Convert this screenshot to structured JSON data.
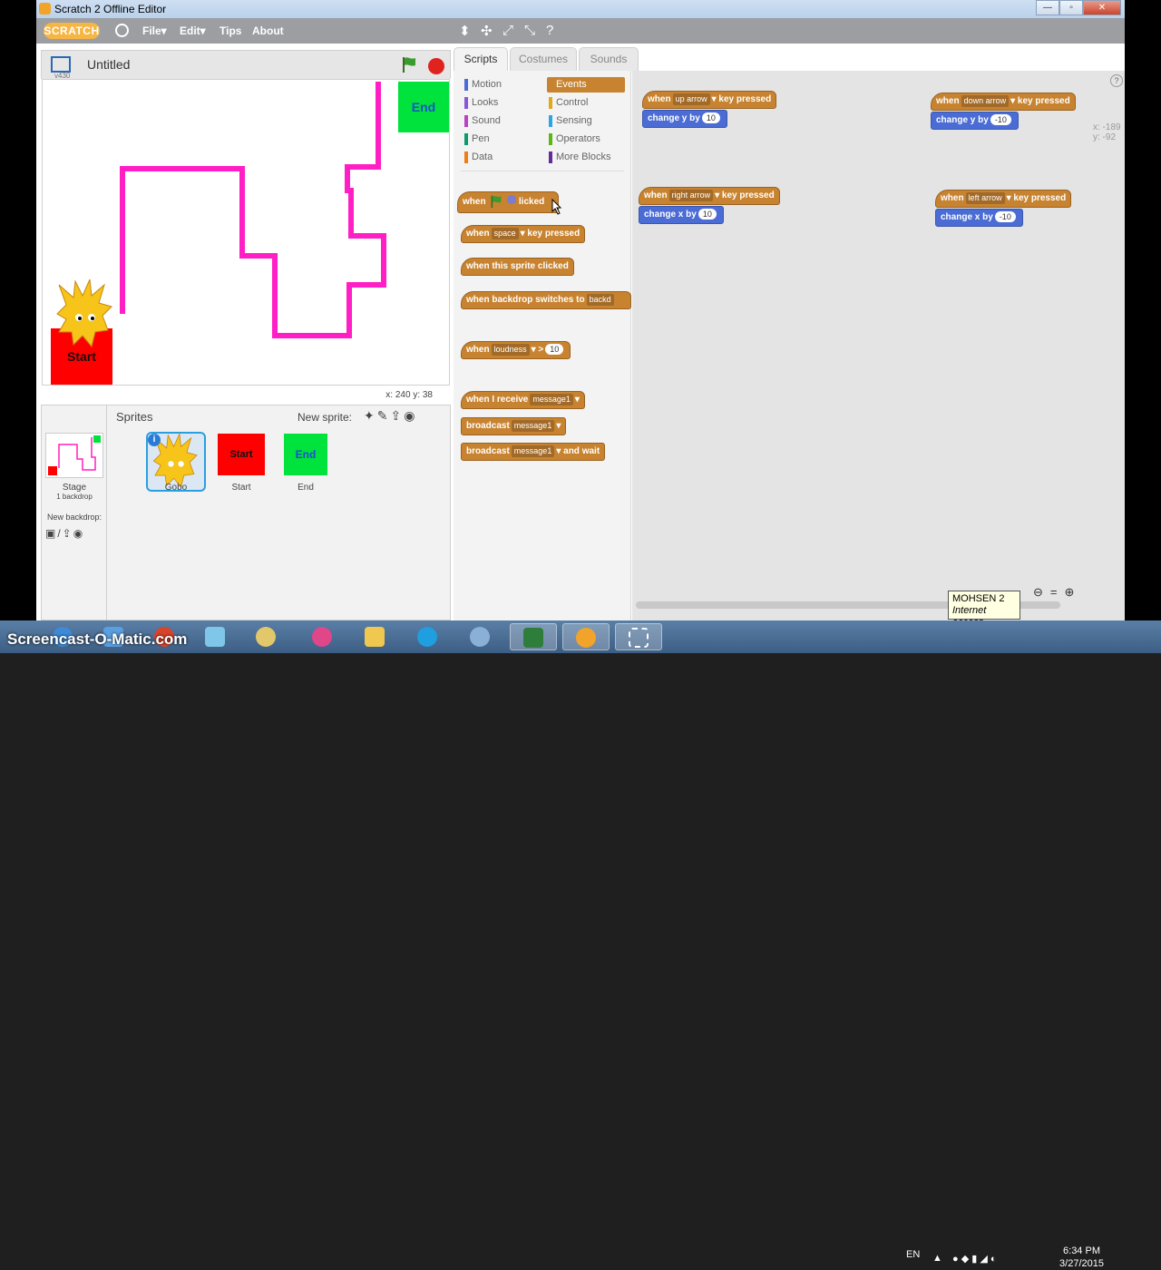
{
  "window": {
    "title": "Scratch 2 Offline Editor"
  },
  "menubar": {
    "logo": "SCRATCH",
    "items": [
      "File",
      "Edit",
      "Tips",
      "About"
    ],
    "file_label": "File▾",
    "edit_label": "Edit▾",
    "tips_label": "Tips",
    "about_label": "About"
  },
  "stage": {
    "version": "v430",
    "project_title": "Untitled",
    "coords": "x: 240  y: 38",
    "end_label": "End",
    "start_label": "Start"
  },
  "sprites_pane": {
    "header": "Sprites",
    "new_sprite": "New sprite:",
    "stage_name": "Stage",
    "stage_backdrops": "1 backdrop",
    "new_backdrop": "New backdrop:",
    "sprites": [
      {
        "name": "Gobo"
      },
      {
        "name": "Start",
        "label": "Start"
      },
      {
        "name": "End",
        "label": "End"
      }
    ]
  },
  "tabs": {
    "scripts": "Scripts",
    "costumes": "Costumes",
    "sounds": "Sounds"
  },
  "categories": {
    "motion": "Motion",
    "looks": "Looks",
    "sound": "Sound",
    "pen": "Pen",
    "data": "Data",
    "events": "Events",
    "control": "Control",
    "sensing": "Sensing",
    "operators": "Operators",
    "more": "More Blocks"
  },
  "palette_blocks": {
    "flag_when": "when",
    "flag_clicked": "licked",
    "key_when": "when",
    "key_drop": "space",
    "key_pressed": "key pressed",
    "sprite_clicked": "when this sprite clicked",
    "backdrop": "when backdrop switches to",
    "backdrop_drop": "backd",
    "loud_when": "when",
    "loud_drop": "loudness",
    "loud_gt": ">",
    "loud_num": "10",
    "recv_when": "when I receive",
    "recv_drop": "message1",
    "broadcast": "broadcast",
    "broadcast_drop": "message1",
    "bwait": "broadcast",
    "bwait_drop": "message1",
    "bwait_tail": "and wait"
  },
  "scripts": [
    {
      "key": "up arrow",
      "action": "change y by",
      "value": "10"
    },
    {
      "key": "down arrow",
      "action": "change y by",
      "value": "-10"
    },
    {
      "key": "right arrow",
      "action": "change x by",
      "value": "10"
    },
    {
      "key": "left arrow",
      "action": "change x by",
      "value": "-10"
    }
  ],
  "script_text": {
    "when": "when",
    "pressed": "key pressed"
  },
  "sprite_info": {
    "x": "x: -189",
    "y": "y: -92"
  },
  "tooltip": {
    "line1": "MOHSEN  2",
    "line2": "Internet access"
  },
  "taskbar": {
    "watermark": "Screencast-O-Matic.com",
    "lang": "EN",
    "time": "6:34 PM",
    "date": "3/27/2015"
  },
  "colors": {
    "events": "#c88330",
    "motion": "#4a6cd4",
    "pen_line": "#ff1fc4",
    "start": "#ff0000",
    "end": "#00e23c"
  }
}
